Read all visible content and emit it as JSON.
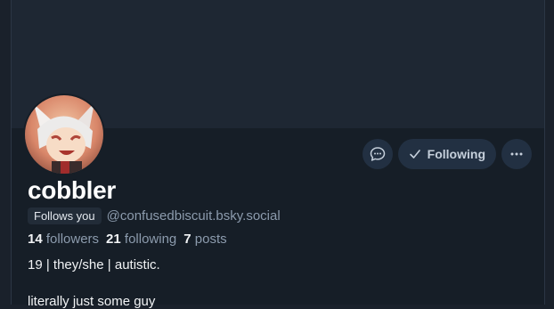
{
  "profile": {
    "display_name": "cobbler",
    "follows_you_label": "Follows you",
    "handle": "@confusedbiscuit.bsky.social",
    "stats": {
      "followers_count": "14",
      "followers_label": "followers",
      "following_count": "21",
      "following_label": "following",
      "posts_count": "7",
      "posts_label": "posts"
    },
    "bio_line1": "19 | they/she | autistic.",
    "bio_line2": "literally just some guy"
  },
  "actions": {
    "message_icon": "chat-bubble-icon",
    "following_label": "Following",
    "more_icon": "ellipsis-icon"
  },
  "colors": {
    "background": "#161e27",
    "banner": "#1e2733",
    "button_bg": "#223042",
    "muted_text": "#8c9bad"
  }
}
